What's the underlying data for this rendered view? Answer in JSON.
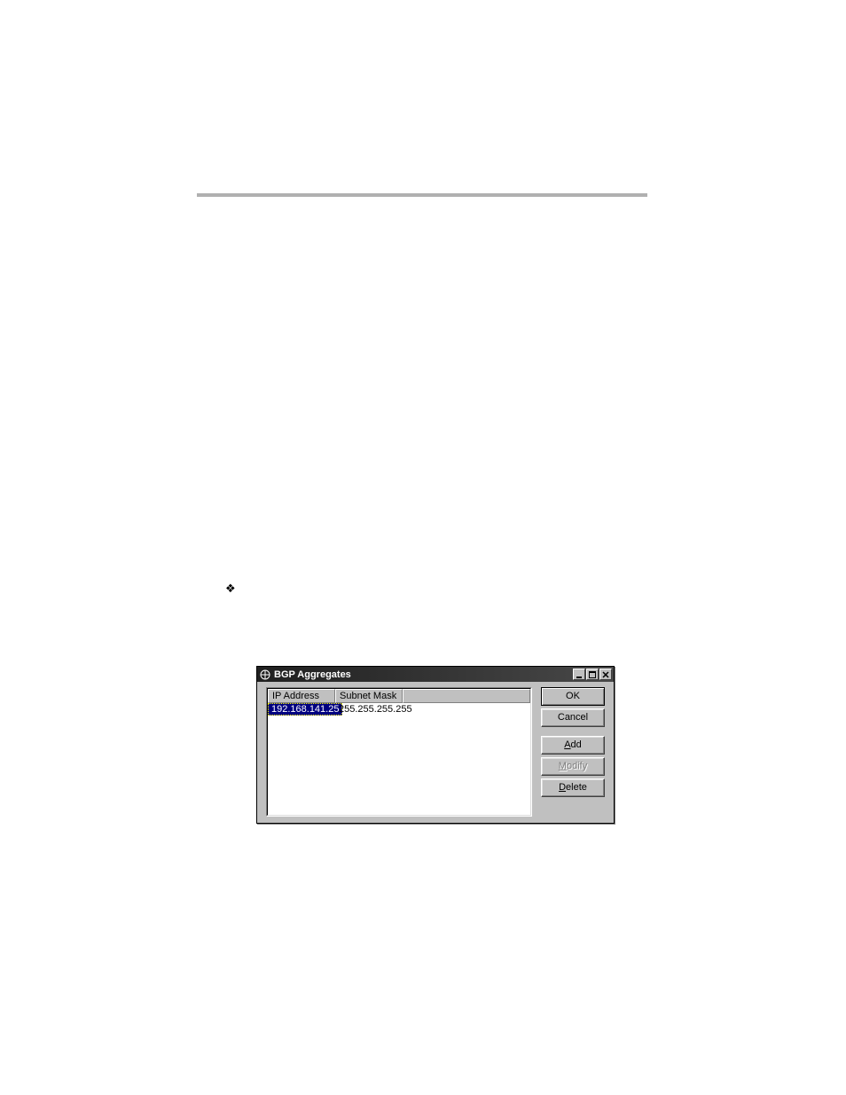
{
  "bullet": "❖",
  "dialog": {
    "title": "BGP Aggregates",
    "columns": {
      "ip": "IP Address",
      "mask": "Subnet Mask"
    },
    "row": {
      "ip": "192.168.141.25",
      "mask": "255.255.255.255"
    },
    "buttons": {
      "ok": "OK",
      "cancel": "Cancel",
      "add_u": "A",
      "add_rest": "dd",
      "modify_u": "M",
      "modify_rest": "odify",
      "delete_u": "D",
      "delete_rest": "elete"
    },
    "controls": {
      "min": "–",
      "max": "□",
      "close": "×"
    }
  }
}
